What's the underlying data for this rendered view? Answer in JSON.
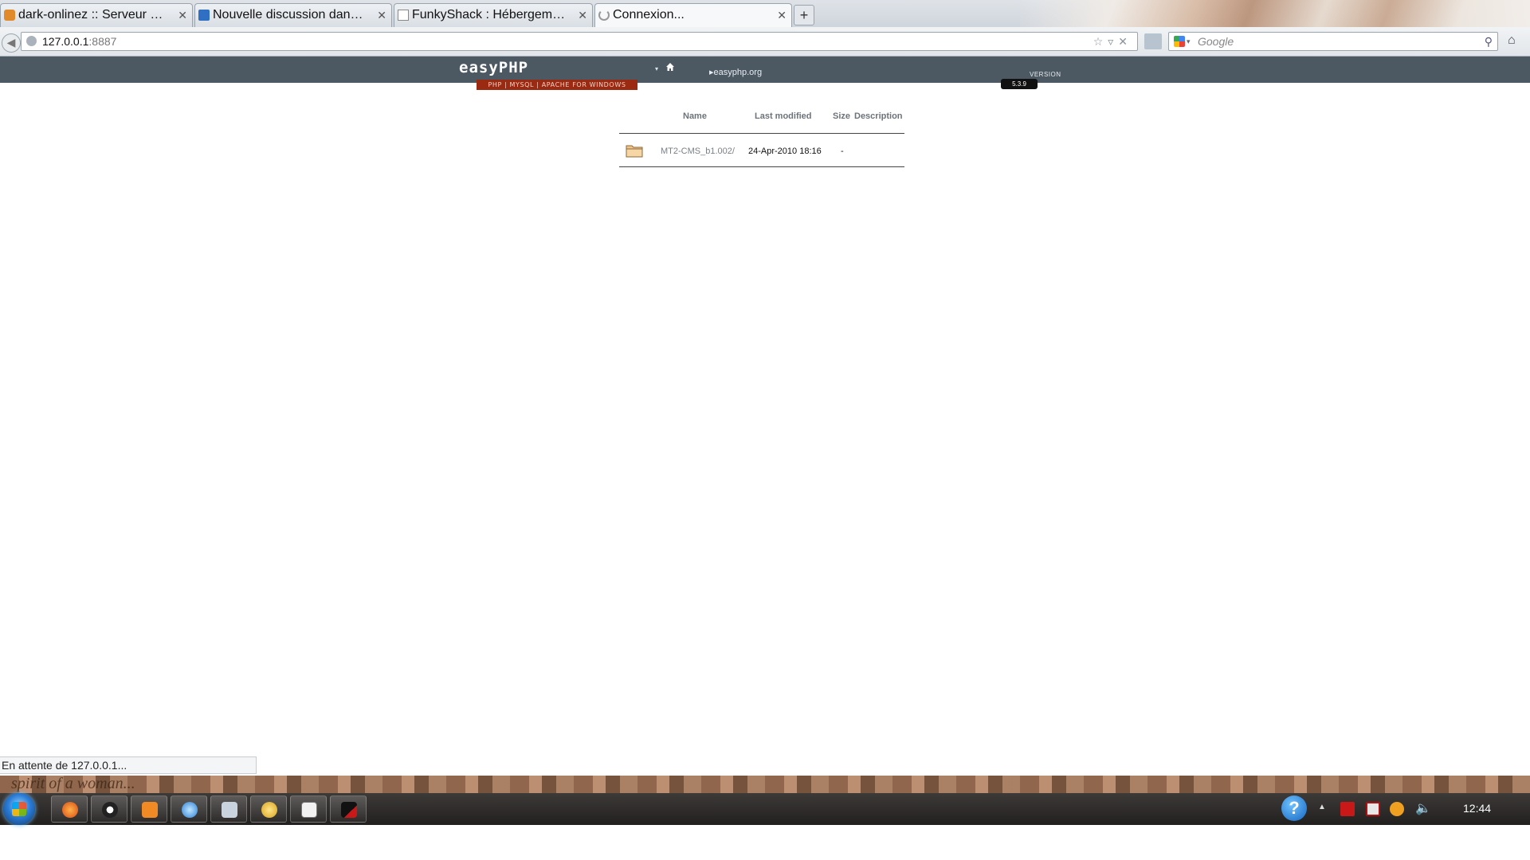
{
  "browser": {
    "tabs": [
      {
        "label": "dark-onlinez :: Serveur privé ..."
      },
      {
        "label": "Nouvelle discussion dans Aid..."
      },
      {
        "label": "FunkyShack : Hébergement d'..."
      },
      {
        "label": "Connexion..."
      }
    ],
    "new_tab": "+",
    "url_host": "127.0.0.1",
    "url_port": ":8887",
    "search_placeholder": "Google",
    "status_text": "En attente de 127.0.0.1..."
  },
  "easyphp": {
    "logo": "easyPHP",
    "tagline": "PHP | MYSQL | APACHE FOR WINDOWS",
    "link": "easyphp.org",
    "version_label": "VERSION",
    "version_number": "5.3.9"
  },
  "listing": {
    "columns": [
      "Name",
      "Last modified",
      "Size",
      "Description"
    ],
    "rows": [
      {
        "name": "MT2-CMS_b1.002/",
        "modified": "24-Apr-2010 18:16",
        "size": "-",
        "description": ""
      }
    ]
  },
  "desktop": {
    "wallpaper_text": "spirit of a woman...",
    "clock": "12:44"
  },
  "colors": {
    "easyphp_header": "#4c5963",
    "easyphp_tagline": "#9b2a12",
    "taskbar": "#2a2827"
  }
}
